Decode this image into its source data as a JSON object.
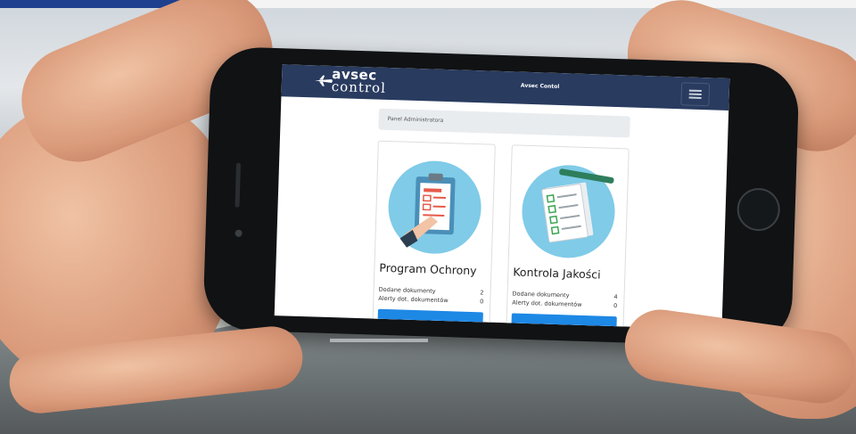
{
  "app": {
    "logo_top": "avsec",
    "logo_bottom": "control",
    "nav_title": "Avsec Contol"
  },
  "breadcrumb": "Panel Administratora",
  "cards": [
    {
      "title": "Program Ochrony",
      "rows": [
        {
          "label": "Dodane dokumenty",
          "value": "2"
        },
        {
          "label": "Alerty dot. dokumentów",
          "value": "0"
        }
      ]
    },
    {
      "title": "Kontrola Jakości",
      "rows": [
        {
          "label": "Dodane dokumenty",
          "value": "4"
        },
        {
          "label": "Alerty dot. dokumentów",
          "value": "0"
        }
      ]
    }
  ],
  "colors": {
    "navbar": "#293b5f",
    "accent_button": "#1e88e5",
    "icon_circle": "#7fcbe8"
  },
  "icons": [
    "clipboard-document-icon",
    "checklist-icon",
    "menu-icon",
    "avsec-logo"
  ]
}
